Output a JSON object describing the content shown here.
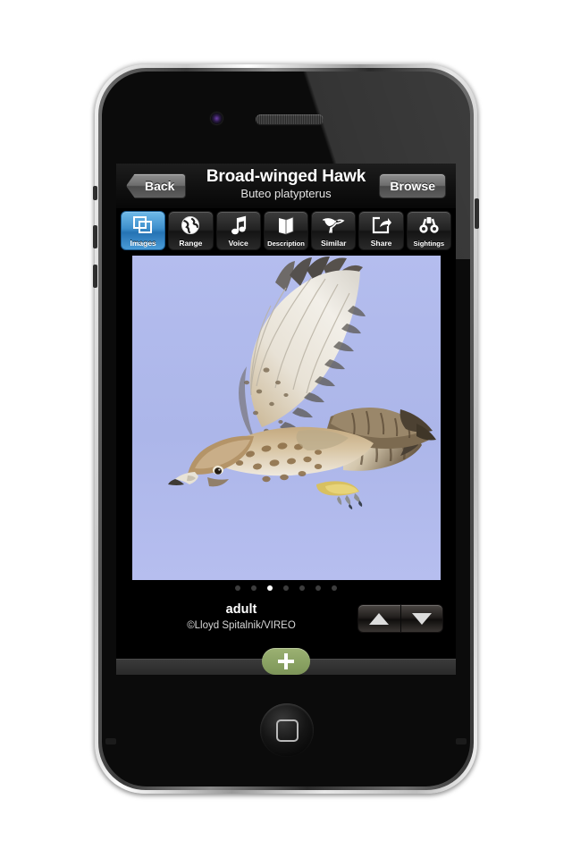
{
  "device": {
    "name": "smartphone",
    "camera_icon": "camera-icon",
    "speaker_icon": "earpiece-speaker-icon",
    "home_icon": "home-button-icon"
  },
  "titlebar": {
    "back_label": "Back",
    "browse_label": "Browse",
    "title": "Broad-winged Hawk",
    "subtitle": "Buteo platypterus"
  },
  "toolbar": {
    "items": [
      {
        "label": "Images",
        "icon": "images-icon",
        "selected": true
      },
      {
        "label": "Range",
        "icon": "globe-icon",
        "selected": false
      },
      {
        "label": "Voice",
        "icon": "music-note-icon",
        "selected": false
      },
      {
        "label": "Description",
        "icon": "book-icon",
        "selected": false
      },
      {
        "label": "Similar",
        "icon": "bird-icon",
        "selected": false
      },
      {
        "label": "Share",
        "icon": "share-icon",
        "selected": false
      },
      {
        "label": "Sightings",
        "icon": "binoculars-icon",
        "selected": false
      }
    ],
    "selected_color": "#3d8fcc"
  },
  "photo": {
    "alt": "Broad-winged Hawk adult in flight against blue sky",
    "sky_color": "#adb8e8",
    "plumage_color": "#c8b393"
  },
  "pager": {
    "total": 7,
    "current": 3
  },
  "caption": {
    "title": "adult",
    "credit": "©Lloyd Spitalnik/VIREO"
  },
  "stepper": {
    "up_label": "previous-image",
    "down_label": "next-image"
  },
  "bottombar": {
    "add_label": "+"
  }
}
